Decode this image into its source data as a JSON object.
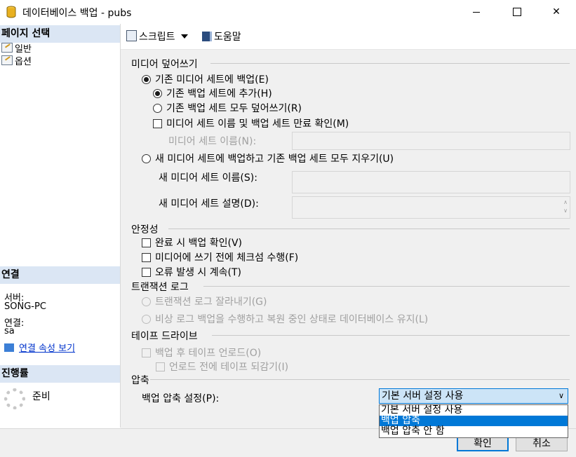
{
  "window": {
    "title": "데이터베이스 백업 - pubs"
  },
  "left": {
    "page_select_header": "페이지 선택",
    "pages": [
      {
        "label": "일반"
      },
      {
        "label": "옵션"
      }
    ],
    "connection_header": "연결",
    "server_label": "서버:",
    "server_value": "SONG-PC",
    "conn_label": "연결:",
    "conn_value": "sa",
    "view_props_link": "연결 속성 보기",
    "progress_header": "진행률",
    "progress_status": "준비"
  },
  "toolbar": {
    "script_label": "스크립트",
    "help_label": "도움말"
  },
  "media": {
    "group_title": "미디어 덮어쓰기",
    "backup_existing": "기존 미디어 세트에 백업(E)",
    "append": "기존 백업 세트에 추가(H)",
    "overwrite": "기존 백업 세트 모두 덮어쓰기(R)",
    "check_media_name": "미디어 세트 이름 및 백업 세트 만료 확인(M)",
    "media_set_name_label": "미디어 세트 이름(N):",
    "media_set_name_value": "",
    "new_media_set": "새 미디어 세트에 백업하고 기존 백업 세트 모두 지우기(U)",
    "new_media_name_label": "새 미디어 세트 이름(S):",
    "new_media_name_value": "",
    "new_media_desc_label": "새 미디어 세트 설명(D):",
    "new_media_desc_value": ""
  },
  "reliability": {
    "group_title": "안정성",
    "verify": "완료 시 백업 확인(V)",
    "checksum": "미디어에 쓰기 전에 체크섬 수행(F)",
    "continue_on_error": "오류 발생 시 계속(T)"
  },
  "transaction_log": {
    "group_title": "트랜잭션 로그",
    "truncate": "트랜잭션 로그 잘라내기(G)",
    "tail_log": "비상 로그 백업을 수행하고 복원 중인 상태로 데이터베이스 유지(L)"
  },
  "tape": {
    "group_title": "테이프 드라이브",
    "unload": "백업 후 테이프 언로드(O)",
    "rewind": "언로드 전에 테이프 되감기(I)"
  },
  "compression": {
    "group_title": "압축",
    "label": "백업 압축 설정(P):",
    "selected": "기본 서버 설정 사용",
    "options": [
      {
        "label": "기본 서버 설정 사용"
      },
      {
        "label": "백업 압축"
      },
      {
        "label": "백업 압축 안 함"
      }
    ]
  },
  "buttons": {
    "ok": "확인",
    "cancel": "취소"
  },
  "colors": {
    "accent": "#0078d7",
    "section_header_bg": "#dbe6f4",
    "dialog_bg": "#f0f0f0"
  }
}
